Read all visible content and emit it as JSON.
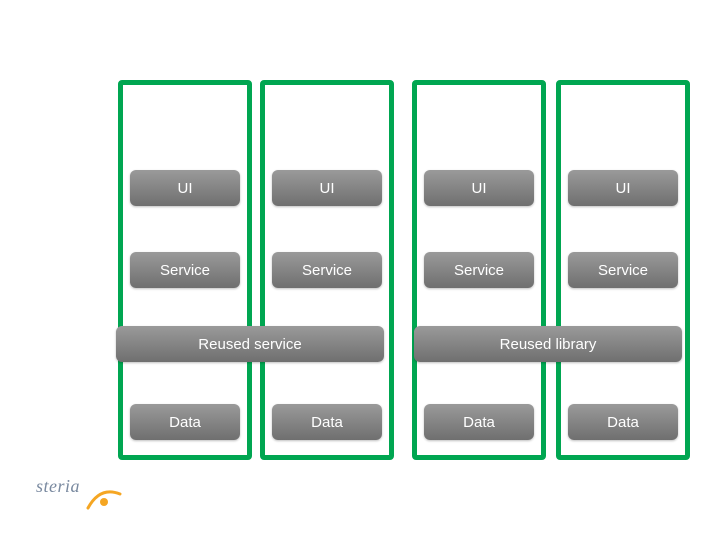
{
  "colors": {
    "column_border": "#00a651",
    "box_gradient_top": "#9a9a9a",
    "box_gradient_bottom": "#6f6f6f",
    "box_text": "#ffffff"
  },
  "columns": [
    {
      "index": 0
    },
    {
      "index": 1
    },
    {
      "index": 2
    },
    {
      "index": 3
    }
  ],
  "rows": {
    "ui": [
      "UI",
      "UI",
      "UI",
      "UI"
    ],
    "service": [
      "Service",
      "Service",
      "Service",
      "Service"
    ],
    "reused": {
      "left_span": "Reused service",
      "right_span": "Reused library"
    },
    "data": [
      "Data",
      "Data",
      "Data",
      "Data"
    ]
  },
  "logo": {
    "text": "steria"
  }
}
